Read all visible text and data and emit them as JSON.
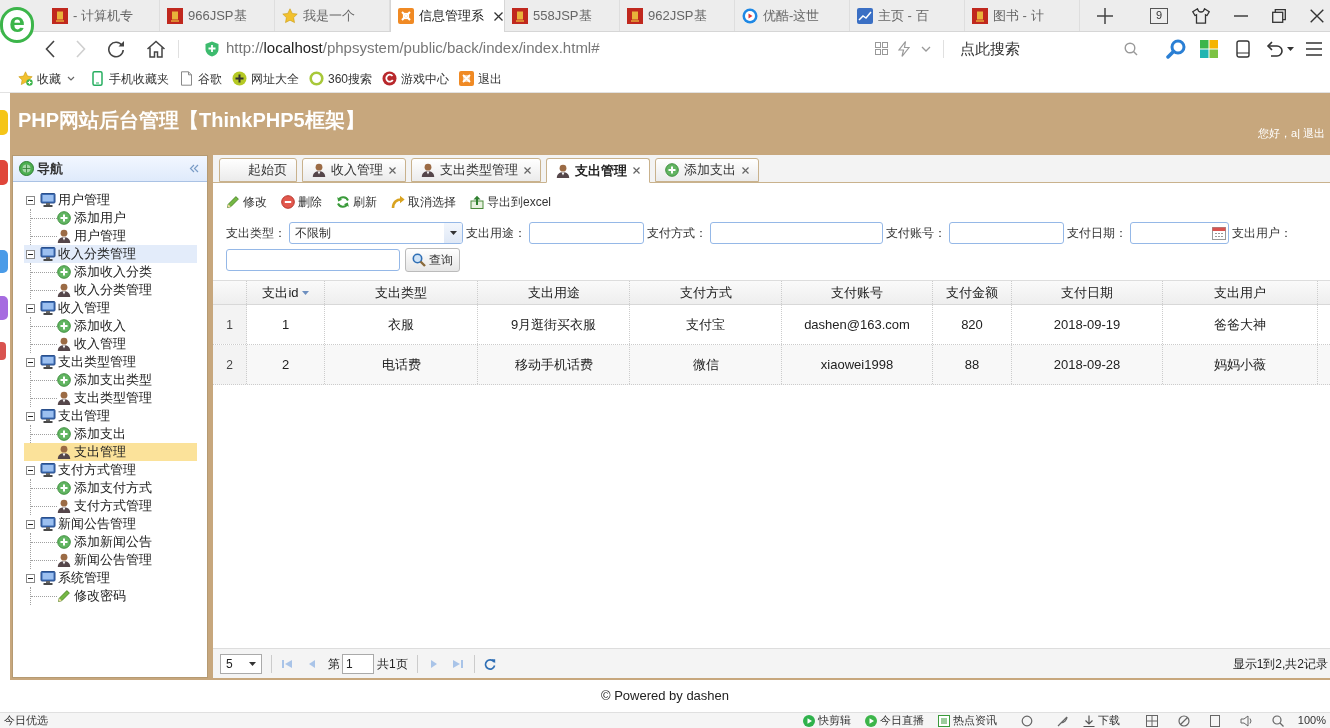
{
  "browser": {
    "logo": "e",
    "tabs": [
      {
        "title": "- 计算机专",
        "kind": "seal",
        "selected": false
      },
      {
        "title": "966JSP基",
        "kind": "seal",
        "selected": false
      },
      {
        "title": "我是一个",
        "kind": "star",
        "selected": false
      },
      {
        "title": "信息管理系",
        "kind": "app",
        "selected": true
      },
      {
        "title": "558JSP基",
        "kind": "seal",
        "selected": false
      },
      {
        "title": "962JSP基",
        "kind": "seal",
        "selected": false
      },
      {
        "title": "优酷-这世",
        "kind": "video",
        "selected": false
      },
      {
        "title": "主页 - 百",
        "kind": "chart",
        "selected": false
      },
      {
        "title": "图书 - 计",
        "kind": "seal",
        "selected": false
      }
    ],
    "tab_count": "9",
    "nav_buttons": [
      {
        "kind": "back",
        "disabled": false
      },
      {
        "kind": "forward",
        "disabled": true
      },
      {
        "kind": "reload",
        "disabled": false
      },
      {
        "kind": "home",
        "disabled": false
      }
    ],
    "url": "http://**localhost**/phpsystem/public/back/index/index.html#",
    "search": {
      "placeholder": "点此搜索"
    },
    "bookmarks": [
      {
        "label": "收藏",
        "kind": "favorites"
      },
      {
        "label": "手机收藏夹",
        "kind": "phone"
      },
      {
        "label": "谷歌",
        "kind": "page"
      },
      {
        "label": "网址大全",
        "kind": "sites"
      },
      {
        "label": "360搜索",
        "kind": "ring"
      },
      {
        "label": "游戏中心",
        "kind": "game"
      },
      {
        "label": "退出",
        "kind": "app"
      }
    ],
    "status_bar": {
      "left": "今日优选",
      "items": [
        {
          "label": "快剪辑",
          "kind": "clip"
        },
        {
          "label": "今日直播",
          "kind": "live"
        },
        {
          "label": "热点资讯",
          "kind": "news"
        },
        {
          "label": "下载",
          "kind": "download"
        }
      ],
      "zoom": "100%"
    }
  },
  "app": {
    "title": "PHP网站后台管理【ThinkPHP5框架】",
    "greeting": "您好，a|",
    "logout": "退出"
  },
  "nav": {
    "title": "导航",
    "groups": [
      {
        "label": "用户管理",
        "expanded": true,
        "hovered": false,
        "children": [
          {
            "label": "添加用户",
            "kind": "add",
            "selected": false
          },
          {
            "label": "用户管理",
            "kind": "manage",
            "selected": false
          }
        ]
      },
      {
        "label": "收入分类管理",
        "expanded": true,
        "hovered": true,
        "children": [
          {
            "label": "添加收入分类",
            "kind": "add",
            "selected": false
          },
          {
            "label": "收入分类管理",
            "kind": "manage",
            "selected": false
          }
        ]
      },
      {
        "label": "收入管理",
        "expanded": true,
        "hovered": false,
        "children": [
          {
            "label": "添加收入",
            "kind": "add",
            "selected": false
          },
          {
            "label": "收入管理",
            "kind": "manage",
            "selected": false
          }
        ]
      },
      {
        "label": "支出类型管理",
        "expanded": true,
        "hovered": false,
        "children": [
          {
            "label": "添加支出类型",
            "kind": "add",
            "selected": false
          },
          {
            "label": "支出类型管理",
            "kind": "manage",
            "selected": false
          }
        ]
      },
      {
        "label": "支出管理",
        "expanded": true,
        "hovered": false,
        "children": [
          {
            "label": "添加支出",
            "kind": "add",
            "selected": false
          },
          {
            "label": "支出管理",
            "kind": "manage",
            "selected": true
          }
        ]
      },
      {
        "label": "支付方式管理",
        "expanded": true,
        "hovered": false,
        "children": [
          {
            "label": "添加支付方式",
            "kind": "add",
            "selected": false
          },
          {
            "label": "支付方式管理",
            "kind": "manage",
            "selected": false
          }
        ]
      },
      {
        "label": "新闻公告管理",
        "expanded": true,
        "hovered": false,
        "children": [
          {
            "label": "添加新闻公告",
            "kind": "add",
            "selected": false
          },
          {
            "label": "新闻公告管理",
            "kind": "manage",
            "selected": false
          }
        ]
      },
      {
        "label": "系统管理",
        "expanded": true,
        "hovered": false,
        "children": [
          {
            "label": "修改密码",
            "kind": "edit",
            "selected": false
          }
        ]
      }
    ]
  },
  "page_tabs": [
    {
      "label": "起始页",
      "kind": "plain",
      "closable": false,
      "selected": false
    },
    {
      "label": "收入管理",
      "kind": "manage",
      "closable": true,
      "selected": false
    },
    {
      "label": "支出类型管理",
      "kind": "manage",
      "closable": true,
      "selected": false
    },
    {
      "label": "支出管理",
      "kind": "manage",
      "closable": true,
      "selected": true
    },
    {
      "label": "添加支出",
      "kind": "add",
      "closable": true,
      "selected": false
    }
  ],
  "toolbar": [
    {
      "label": "修改",
      "kind": "edit"
    },
    {
      "label": "删除",
      "kind": "delete"
    },
    {
      "label": "刷新",
      "kind": "refresh"
    },
    {
      "label": "取消选择",
      "kind": "deselect"
    },
    {
      "label": "导出到excel",
      "kind": "export"
    }
  ],
  "filters": [
    {
      "label": "支出类型：",
      "kind": "select",
      "value": "不限制"
    },
    {
      "label": "支出用途：",
      "kind": "text"
    },
    {
      "label": "支付方式：",
      "kind": "text"
    },
    {
      "label": "支付账号：",
      "kind": "text"
    },
    {
      "label": "支付日期：",
      "kind": "date"
    },
    {
      "label": "支出用户：",
      "kind": "text"
    }
  ],
  "search_button": "查询",
  "table": {
    "columns": [
      {
        "label": "支出id",
        "sorted": true
      },
      {
        "label": "支出类型",
        "sorted": false
      },
      {
        "label": "支出用途",
        "sorted": false
      },
      {
        "label": "支付方式",
        "sorted": false
      },
      {
        "label": "支付账号",
        "sorted": false
      },
      {
        "label": "支付金额",
        "sorted": false
      },
      {
        "label": "支付日期",
        "sorted": false
      },
      {
        "label": "支出用户",
        "sorted": false
      }
    ],
    "rows": [
      {
        "number": "1",
        "cells": [
          "1",
          "衣服",
          "9月逛街买衣服",
          "支付宝",
          "dashen@163.com",
          "820",
          "2018-09-19",
          "爸爸大神"
        ]
      },
      {
        "number": "2",
        "cells": [
          "2",
          "电话费",
          "移动手机话费",
          "微信",
          "xiaowei1998",
          "88",
          "2018-09-28",
          "妈妈小薇"
        ]
      }
    ]
  },
  "pager": {
    "page_size": "5",
    "page_prefix": "第",
    "page": "1",
    "page_suffix": "共1页",
    "summary": "显示1到2,共2记录",
    "buttons": [
      {
        "kind": "first",
        "disabled": true
      },
      {
        "kind": "prev",
        "disabled": true
      },
      {
        "kind": "next",
        "disabled": true
      },
      {
        "kind": "last",
        "disabled": true
      },
      {
        "kind": "refresh",
        "disabled": false
      }
    ]
  },
  "footer": "© Powered by dashen"
}
